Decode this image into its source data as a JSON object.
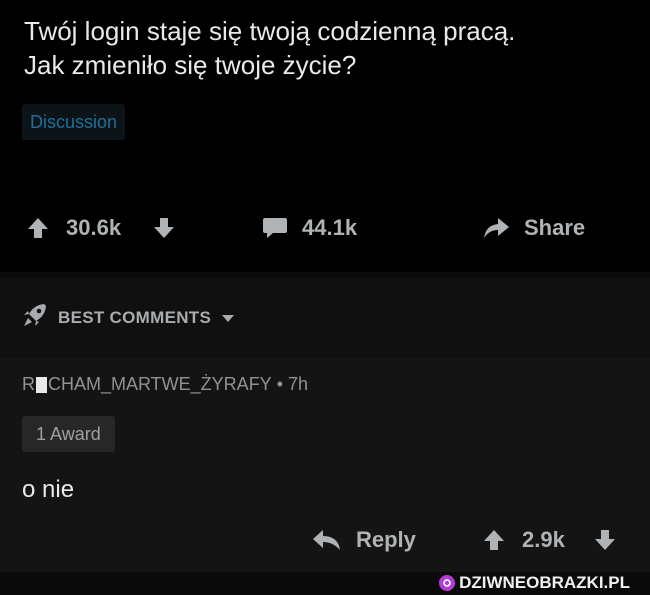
{
  "post": {
    "title": "Twój login staje się twoją codzienną pracą.\nJak zmieniło się twoje życie?",
    "flair": "Discussion",
    "upvotes": "30.6k",
    "comments": "44.1k",
    "share_label": "Share"
  },
  "sort": {
    "label": "BEST COMMENTS"
  },
  "comment": {
    "author_prefix": "R",
    "author_rest": "CHAM_MARTWE_ŻYRAFY",
    "meta": " • 7h",
    "award": "1 Award",
    "body": "o nie",
    "reply_label": "Reply",
    "score": "2.9k"
  },
  "watermark": {
    "text": "DZIWNEOBRAZKI.PL"
  },
  "colors": {
    "background": "#000000",
    "flair_text": "#1f6f9a",
    "icon": "#b0b3b5",
    "watermark_logo": "#b23cd6"
  }
}
